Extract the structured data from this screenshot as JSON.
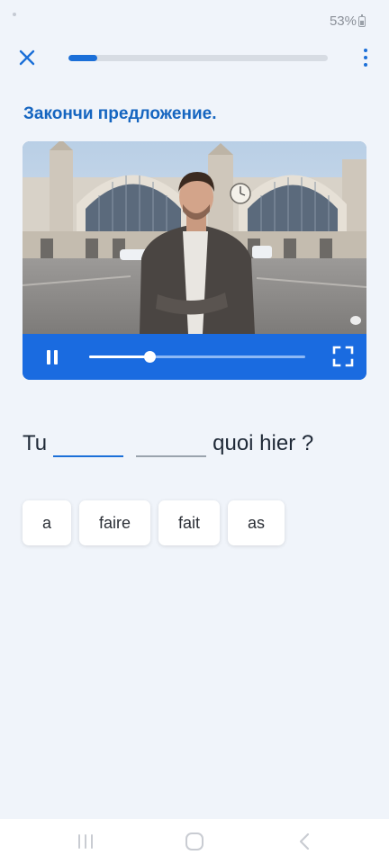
{
  "status_bar": {
    "battery_text": "53%",
    "battery_icon": "battery-icon"
  },
  "top_bar": {
    "close_icon": "close-icon",
    "menu_icon": "more-vertical-icon",
    "lesson_progress": 0.11,
    "accent_color": "#1b6fd8"
  },
  "instruction": "Закончи предложение.",
  "video": {
    "pause_icon": "pause-icon",
    "fullscreen_icon": "fullscreen-icon",
    "playback_progress": 0.28,
    "controls_color": "#1a6be0"
  },
  "sentence": {
    "prefix": "Tu",
    "blanks": [
      "",
      ""
    ],
    "suffix": "quoi hier ?"
  },
  "word_options": [
    "a",
    "faire",
    "fait",
    "as"
  ],
  "nav_bar": {
    "recents_icon": "recents-icon",
    "home_icon": "home-icon",
    "back_icon": "back-icon"
  }
}
